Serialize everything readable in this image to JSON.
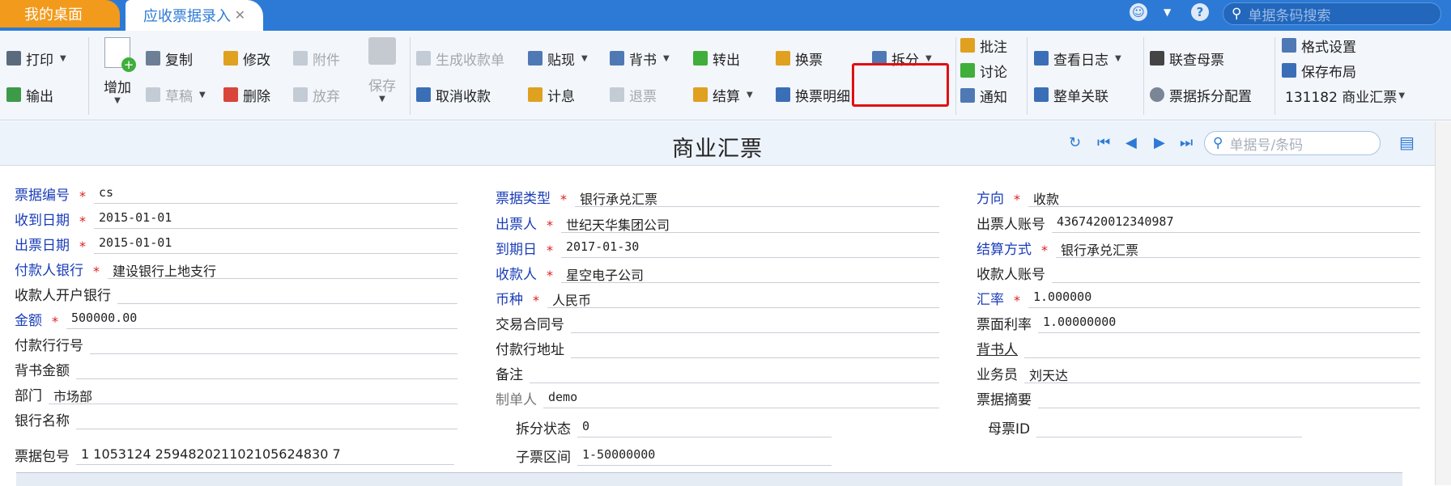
{
  "tabs": {
    "home": "我的桌面",
    "active": "应收票据录入"
  },
  "topbar": {
    "search_placeholder": "单据条码搜索"
  },
  "toolbar": {
    "print": "打印",
    "export": "输出",
    "add": "增加",
    "copy": "复制",
    "draft": "草稿",
    "edit": "修改",
    "delete": "删除",
    "attach": "附件",
    "abandon": "放弃",
    "save": "保存",
    "gen_receipt": "生成收款单",
    "cancel_receipt": "取消收款",
    "discount": "贴现",
    "interest": "计息",
    "endorse": "背书",
    "return": "退票",
    "transfer": "转出",
    "settle": "结算",
    "exchange": "换票",
    "exchange_detail": "换票明细",
    "split": "拆分",
    "annotate": "批注",
    "discuss": "讨论",
    "notify": "通知",
    "view_log": "查看日志",
    "doc_link": "整单关联",
    "link_parent": "联查母票",
    "split_config": "票据拆分配置",
    "format_settings": "格式设置",
    "save_layout": "保存布局",
    "template": "131182 商业汇票"
  },
  "form": {
    "title": "商业汇票",
    "search_placeholder": "单据号/条码",
    "labels": {
      "bill_no": "票据编号",
      "bill_type": "票据类型",
      "direction": "方向",
      "recv_date": "收到日期",
      "drawer": "出票人",
      "drawer_account": "出票人账号",
      "issue_date": "出票日期",
      "due_date": "到期日",
      "settle_method": "结算方式",
      "payer_bank": "付款人银行",
      "payee": "收款人",
      "payee_account": "收款人账号",
      "payee_bank": "收款人开户银行",
      "currency": "币种",
      "rate": "汇率",
      "amount": "金额",
      "contract_no": "交易合同号",
      "face_rate": "票面利率",
      "payer_bank_no": "付款行行号",
      "payer_bank_addr": "付款行地址",
      "endorser": "背书人",
      "endorse_amount": "背书金额",
      "remark": "备注",
      "salesman": "业务员",
      "dept": "部门",
      "creator": "制单人",
      "summary": "票据摘要",
      "bank_name": "银行名称",
      "split_status": "拆分状态",
      "parent_id": "母票ID",
      "package_no": "票据包号",
      "child_range": "子票区间"
    },
    "values": {
      "bill_no": "cs",
      "bill_type": "银行承兑汇票",
      "direction": "收款",
      "recv_date": "2015-01-01",
      "drawer": "世纪天华集团公司",
      "drawer_account": "4367420012340987",
      "issue_date": "2015-01-01",
      "due_date": "2017-01-30",
      "settle_method": "银行承兑汇票",
      "payer_bank": "建设银行上地支行",
      "payee": "星空电子公司",
      "payee_account": "",
      "payee_bank": "",
      "currency": "人民币",
      "rate": "1.000000",
      "amount": "500000.00",
      "contract_no": "",
      "face_rate": "1.00000000",
      "payer_bank_no": "",
      "payer_bank_addr": "",
      "endorser": "",
      "endorse_amount": "",
      "remark": "",
      "salesman": "刘天达",
      "dept": "市场部",
      "creator": "demo",
      "summary": "",
      "bank_name": "",
      "split_status": "0",
      "parent_id": "",
      "package_no": "1 1053124 259482021102105624830 7",
      "child_range": "1-50000000"
    }
  },
  "colors": {
    "accent": "#2c7ad6",
    "home_tab": "#f29a1b",
    "required_label": "#1a3db8",
    "required_star": "#e02020",
    "highlight_box": "#e01010"
  }
}
